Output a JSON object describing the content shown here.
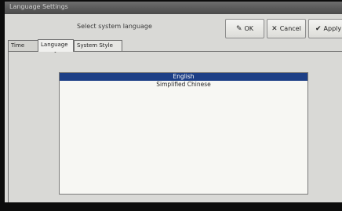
{
  "window": {
    "title": "Language Settings"
  },
  "header": {
    "instruction": "Select system language"
  },
  "toolbar": {
    "ok_label": "OK",
    "cancel_label": "Cancel",
    "apply_label": "Apply",
    "ok_icon": "pencil-icon",
    "cancel_icon": "x-icon",
    "apply_icon": "check-icon"
  },
  "tabs": [
    {
      "label": "Time",
      "selected": false
    },
    {
      "label": "Language",
      "selected": true
    },
    {
      "label": "System Style",
      "selected": false
    }
  ],
  "language_list": {
    "items": [
      {
        "label": "English",
        "selected": true
      },
      {
        "label": "Simplified Chinese",
        "selected": false
      }
    ]
  },
  "colors": {
    "selection": "#1d3f86",
    "titlebar": "#4a4a4a",
    "dialog_bg": "#d9d9d6",
    "list_bg": "#f7f7f3"
  }
}
